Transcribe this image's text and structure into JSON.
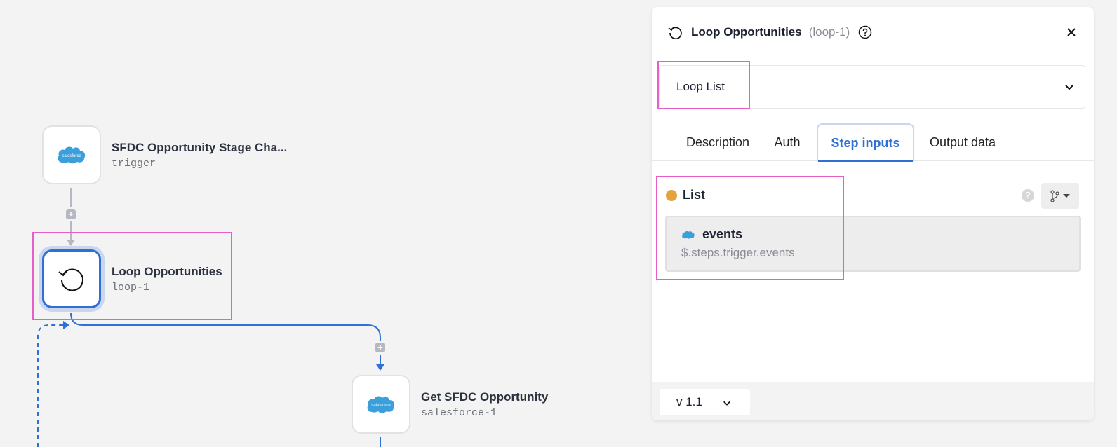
{
  "canvas": {
    "nodes": [
      {
        "title": "SFDC Opportunity Stage Cha...",
        "sub": "trigger",
        "icon": "salesforce-icon",
        "icon_text": "salesforce"
      },
      {
        "title": "Loop Opportunities",
        "sub": "loop-1",
        "icon": "loop-icon"
      },
      {
        "title": "Get SFDC Opportunity",
        "sub": "salesforce-1",
        "icon": "salesforce-icon",
        "icon_text": "salesforce"
      }
    ],
    "plus_label": "+",
    "colors": {
      "selected": "#2f6fd6",
      "highlight": "#e75fc6",
      "connector": "#b5b8c0",
      "salesforce": "#3b9fdc"
    }
  },
  "panel": {
    "title": "Loop Opportunities",
    "id": "(loop-1)",
    "action_select": "Loop List",
    "tabs": [
      {
        "label": "Description",
        "active": false
      },
      {
        "label": "Auth",
        "active": false
      },
      {
        "label": "Step inputs",
        "active": true
      },
      {
        "label": "Output data",
        "active": false
      }
    ],
    "input": {
      "label": "List",
      "help": "?",
      "status_color": "#e5a33b",
      "value_name": "events",
      "value_path": "$.steps.trigger.events"
    },
    "version": "v 1.1"
  }
}
